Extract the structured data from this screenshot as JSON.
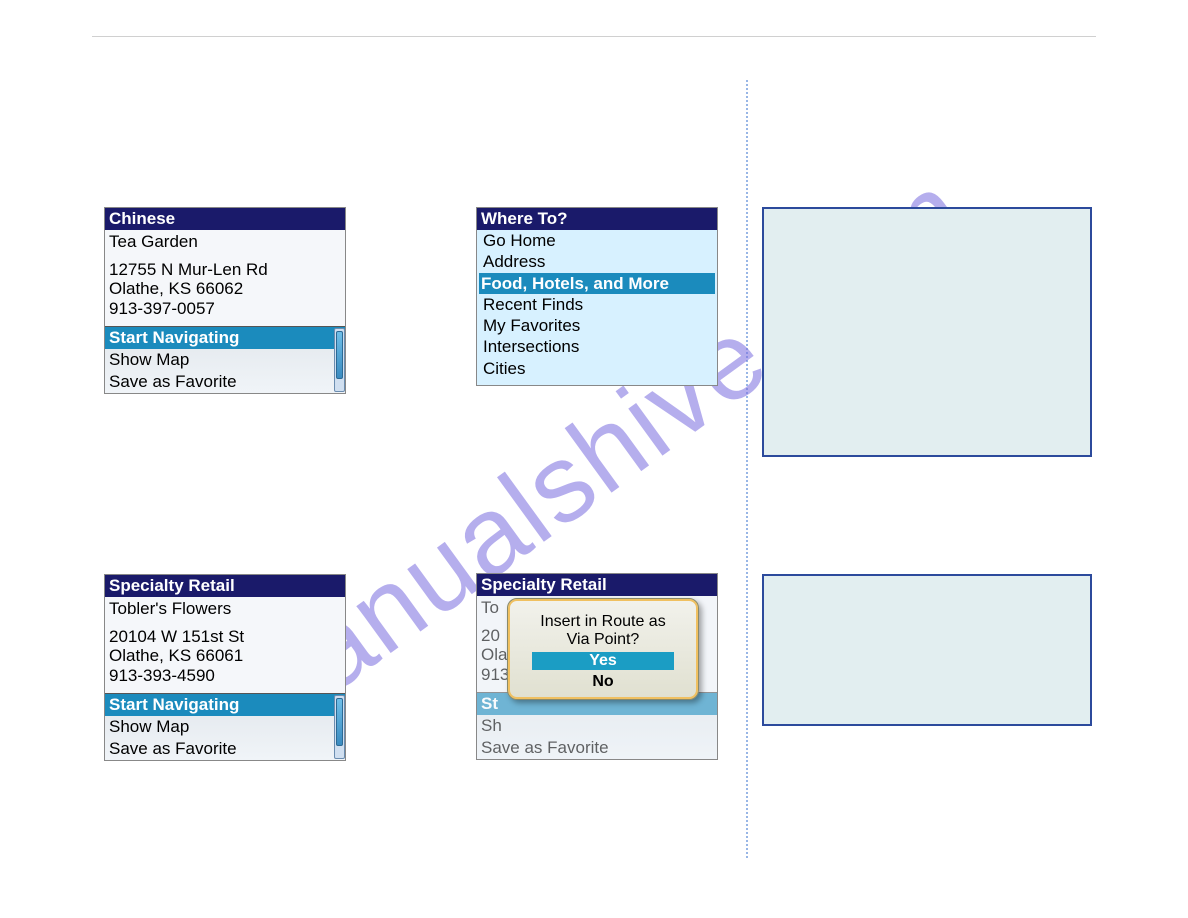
{
  "watermark": "manualshive.com",
  "screen1a": {
    "title": "Chinese",
    "name": "Tea Garden",
    "addr1": "12755 N Mur-Len Rd",
    "addr2": "Olathe, KS 66062",
    "phone": "913-397-0057",
    "menu": {
      "start": "Start Navigating",
      "map": "Show Map",
      "fav": "Save as Favorite"
    }
  },
  "screen1b": {
    "title": "Where To?",
    "items": {
      "home": "Go Home",
      "address": "Address",
      "food": "Food, Hotels, and More",
      "recent": "Recent Finds",
      "fav": "My Favorites",
      "inter": "Intersections",
      "cities": "Cities"
    }
  },
  "screen2a": {
    "title": "Specialty Retail",
    "name": "Tobler's Flowers",
    "addr1": "20104 W 151st St",
    "addr2": "Olathe, KS 66061",
    "phone": "913-393-4590",
    "menu": {
      "start": "Start Navigating",
      "map": "Show Map",
      "fav": "Save as Favorite"
    }
  },
  "screen2b": {
    "title": "Specialty Retail",
    "name": "To",
    "addr1": "20",
    "addr2": "Ola",
    "phone": "913",
    "menu": {
      "start": "St",
      "map": "Sh",
      "fav": "Save as Favorite"
    },
    "dialog": {
      "q1": "Insert in Route as",
      "q2": "Via Point?",
      "yes": "Yes",
      "no": "No"
    }
  }
}
